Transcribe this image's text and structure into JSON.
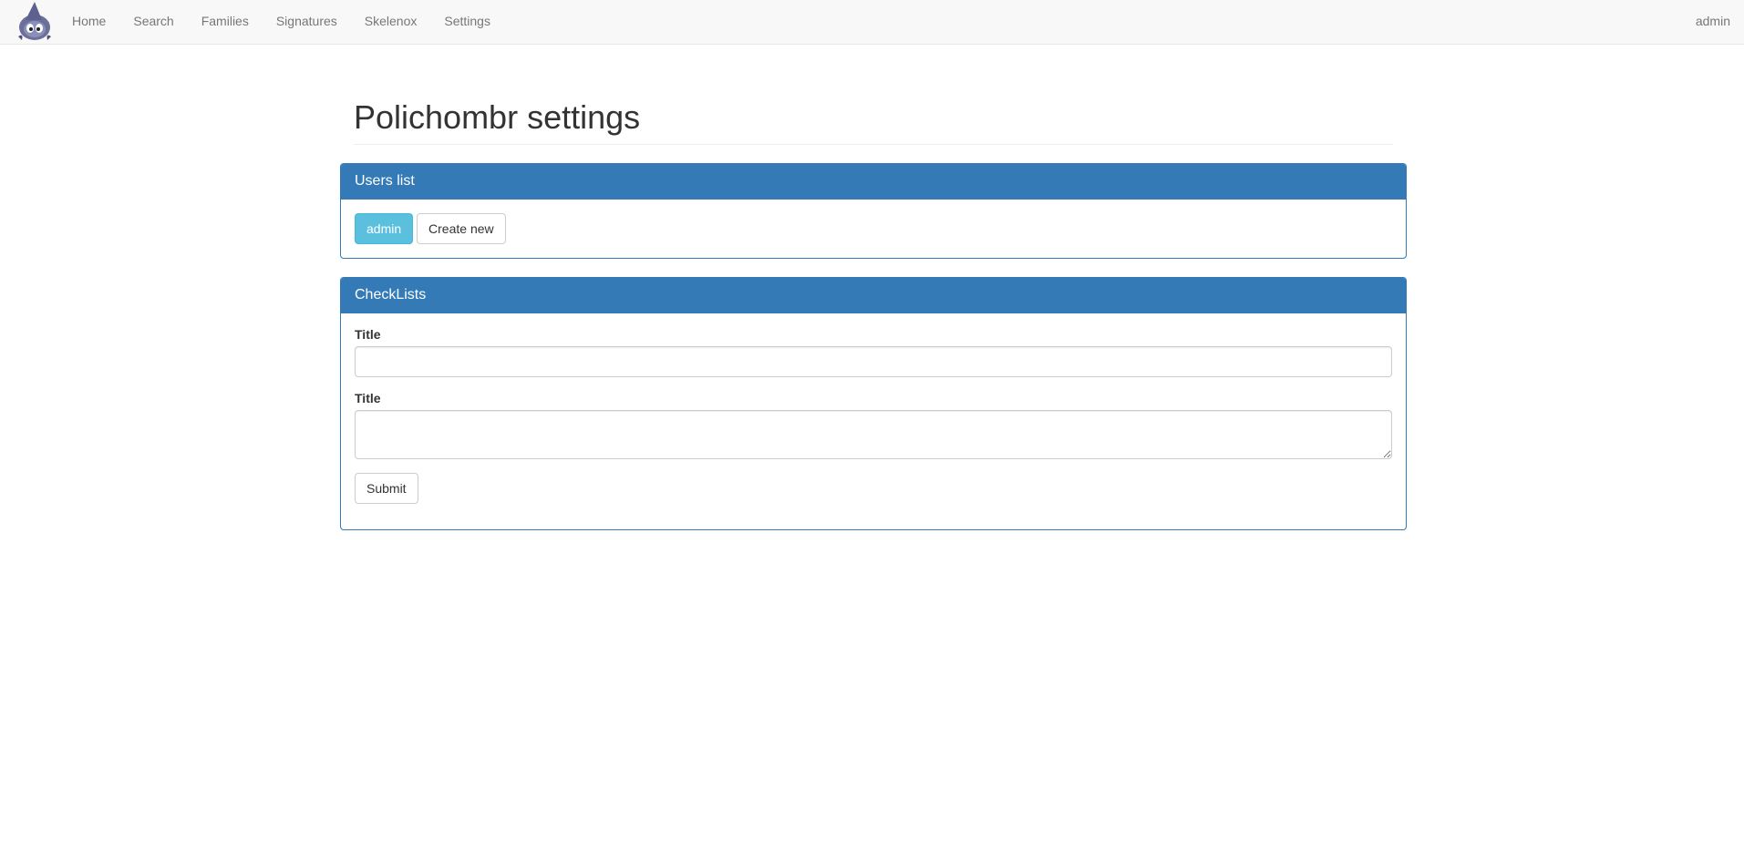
{
  "navbar": {
    "brand_icon": "ghost-mascot-icon",
    "links": [
      "Home",
      "Search",
      "Families",
      "Signatures",
      "Skelenox",
      "Settings"
    ],
    "user": "admin"
  },
  "page": {
    "title": "Polichombr settings"
  },
  "users_panel": {
    "heading": "Users list",
    "user_button": "admin",
    "create_button": "Create new"
  },
  "checklists_panel": {
    "heading": "CheckLists",
    "field1_label": "Title",
    "field1_value": "",
    "field2_label": "Title",
    "field2_value": "",
    "submit_label": "Submit"
  },
  "colors": {
    "primary": "#337ab7",
    "info": "#5bc0de",
    "navbar_bg": "#f8f8f8"
  }
}
